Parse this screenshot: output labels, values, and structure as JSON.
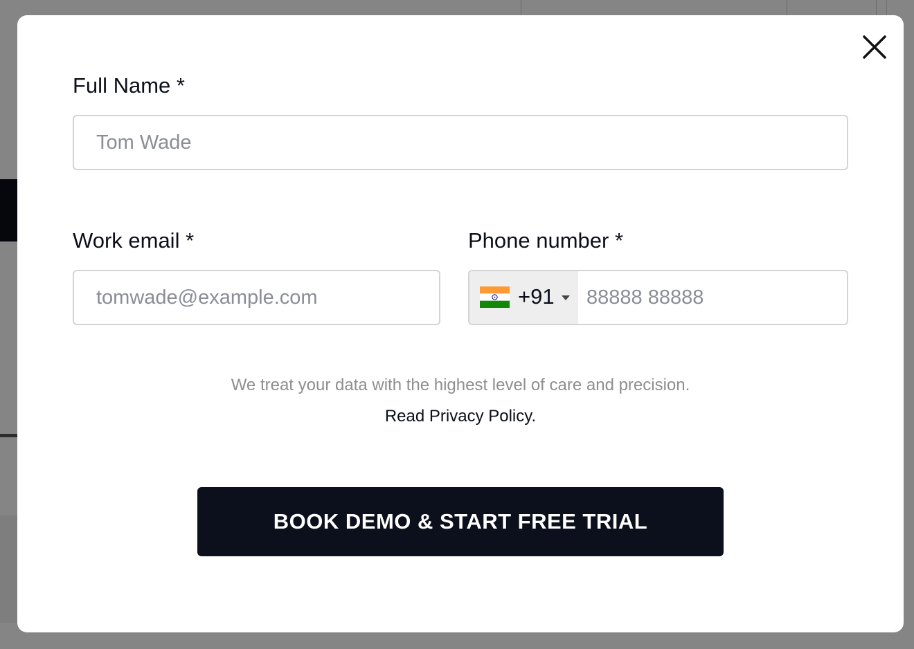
{
  "form": {
    "full_name": {
      "label": "Full Name *",
      "placeholder": "Tom Wade"
    },
    "work_email": {
      "label": "Work email *",
      "placeholder": "tomwade@example.com"
    },
    "phone": {
      "label": "Phone number *",
      "country_flag": "india-flag-icon",
      "dial_code": "+91",
      "placeholder": "88888 88888"
    },
    "privacy_text": "We treat your data with the highest level of care and precision.",
    "privacy_link": "Read Privacy Policy.",
    "submit_label": "BOOK DEMO & START FREE TRIAL"
  },
  "icons": {
    "close": "close-icon",
    "caret": "caret-down-icon"
  },
  "colors": {
    "primary": "#0c101c",
    "label": "#0c0f19",
    "muted": "#8e8e8e",
    "input_border": "#d4d4d4",
    "country_bg": "#eeeeee",
    "flag_saffron": "#ff9933",
    "flag_white": "#ffffff",
    "flag_green": "#138808",
    "flag_chakra": "#000080"
  }
}
